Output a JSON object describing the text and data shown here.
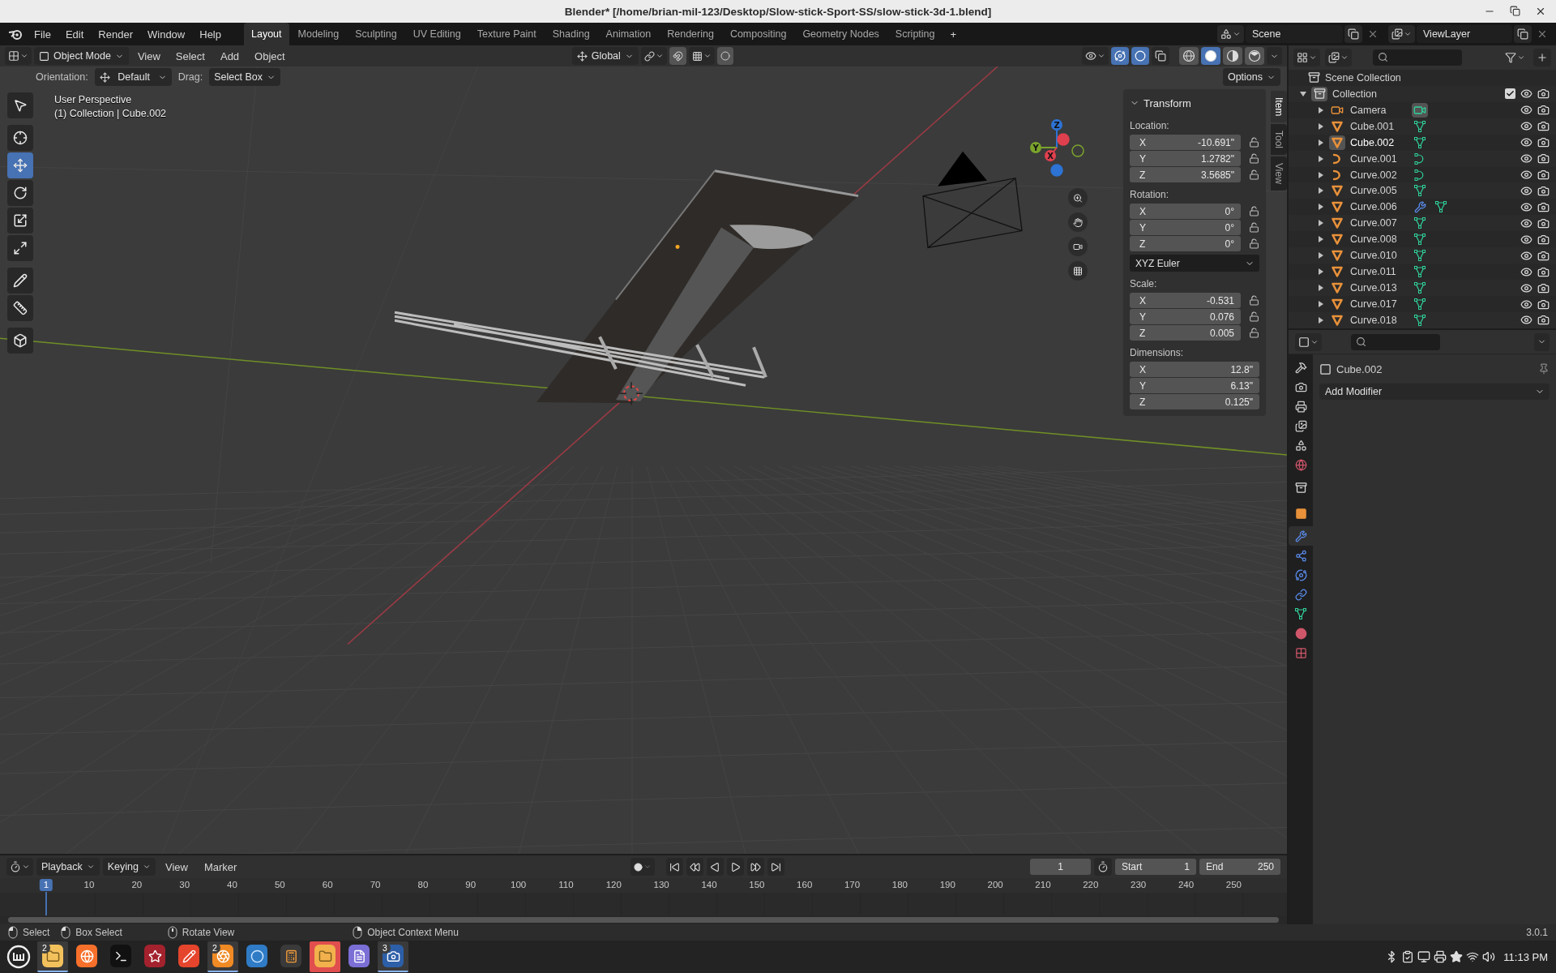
{
  "window": {
    "title": "Blender* [/home/brian-mil-123/Desktop/Slow-stick-Sport-SS/slow-stick-3d-1.blend]"
  },
  "menu": [
    "File",
    "Edit",
    "Render",
    "Window",
    "Help"
  ],
  "workspaces": [
    {
      "label": "Layout",
      "selected": true
    },
    {
      "label": "Modeling",
      "selected": false
    },
    {
      "label": "Sculpting",
      "selected": false
    },
    {
      "label": "UV Editing",
      "selected": false
    },
    {
      "label": "Texture Paint",
      "selected": false
    },
    {
      "label": "Shading",
      "selected": false
    },
    {
      "label": "Animation",
      "selected": false
    },
    {
      "label": "Rendering",
      "selected": false
    },
    {
      "label": "Compositing",
      "selected": false
    },
    {
      "label": "Geometry Nodes",
      "selected": false
    },
    {
      "label": "Scripting",
      "selected": false
    }
  ],
  "add_workspace": "+",
  "scene": "Scene",
  "view_layer": "ViewLayer",
  "viewport": {
    "mode": "Object Mode",
    "menu": [
      "View",
      "Select",
      "Add",
      "Object"
    ],
    "transform_orientation": "Global",
    "toggles": [
      {
        "kind": "gizmos",
        "on": true
      },
      {
        "kind": "overlays",
        "on": true
      },
      {
        "kind": "xray",
        "on": false
      }
    ],
    "shading": [
      {
        "kind": "wireframe",
        "selected": false
      },
      {
        "kind": "solid",
        "selected": true
      },
      {
        "kind": "material",
        "selected": false
      },
      {
        "kind": "rendered",
        "selected": false
      }
    ],
    "tool_settings": {
      "orientation_label": "Orientation:",
      "orientation": "Default",
      "drag_label": "Drag:",
      "drag": "Select Box",
      "options": "Options"
    },
    "tools": [
      {
        "kind": "select",
        "selected": false
      },
      {
        "kind": "cursor",
        "selected": false
      },
      {
        "kind": "move",
        "selected": true
      },
      {
        "kind": "rotate",
        "selected": false
      },
      {
        "kind": "scale",
        "selected": false
      },
      {
        "kind": "transform",
        "selected": false
      },
      {
        "kind": "annotate",
        "selected": false
      },
      {
        "kind": "measure",
        "selected": false
      },
      {
        "kind": "add-cube",
        "selected": false
      }
    ],
    "overlay_text": [
      "User Perspective",
      "(1) Collection | Cube.002"
    ],
    "gizmo_axes": [
      {
        "kind": "z",
        "label": "Z",
        "color": "#2d73d4"
      },
      {
        "kind": "y",
        "label": "Y",
        "color": "#7ba32c"
      },
      {
        "kind": "x",
        "label": "X",
        "color": "#e0404e"
      }
    ],
    "sidebar_tabs": [
      {
        "label": "Item",
        "selected": true
      },
      {
        "label": "Tool",
        "selected": false
      },
      {
        "label": "View",
        "selected": false
      }
    ],
    "transform": {
      "title": "Transform",
      "sections": [
        {
          "kind": "vector",
          "label": "Location:",
          "locked": false,
          "fields": [
            {
              "axis": "X",
              "value": "-10.691\""
            },
            {
              "axis": "Y",
              "value": "1.2782\""
            },
            {
              "axis": "Z",
              "value": "3.5685\""
            }
          ]
        },
        {
          "kind": "vector",
          "label": "Rotation:",
          "locked": false,
          "fields": [
            {
              "axis": "X",
              "value": "0°"
            },
            {
              "axis": "Y",
              "value": "0°"
            },
            {
              "axis": "Z",
              "value": "0°"
            }
          ]
        },
        {
          "kind": "dropdown",
          "value": "XYZ Euler"
        },
        {
          "kind": "vector",
          "label": "Scale:",
          "locked": false,
          "fields": [
            {
              "axis": "X",
              "value": "-0.531"
            },
            {
              "axis": "Y",
              "value": "0.076"
            },
            {
              "axis": "Z",
              "value": "0.005"
            }
          ]
        },
        {
          "kind": "vector",
          "label": "Dimensions:",
          "fields": [
            {
              "axis": "X",
              "value": "12.8\""
            },
            {
              "axis": "Y",
              "value": "6.13\""
            },
            {
              "axis": "Z",
              "value": "0.125\""
            }
          ]
        }
      ]
    }
  },
  "outliner": {
    "root": "Scene Collection",
    "collections": [
      {
        "name": "Collection",
        "expanded": true,
        "checked": true,
        "children": [
          {
            "name": "Camera",
            "kind": "camera",
            "data": [
              {
                "kind": "camera"
              }
            ],
            "data_active": true,
            "selected": false
          },
          {
            "name": "Cube.001",
            "kind": "mesh",
            "data": [
              {
                "kind": "mesh"
              }
            ],
            "data_active": false,
            "selected": false
          },
          {
            "name": "Cube.002",
            "kind": "mesh",
            "data": [
              {
                "kind": "mesh"
              }
            ],
            "data_active": false,
            "selected": true
          },
          {
            "name": "Curve.001",
            "kind": "curve",
            "data": [
              {
                "kind": "curve"
              }
            ],
            "data_active": false,
            "selected": false
          },
          {
            "name": "Curve.002",
            "kind": "curve",
            "data": [
              {
                "kind": "curve"
              }
            ],
            "data_active": false,
            "selected": false
          },
          {
            "name": "Curve.005",
            "kind": "mesh",
            "data": [
              {
                "kind": "mesh"
              }
            ],
            "data_active": false,
            "selected": false
          },
          {
            "name": "Curve.006",
            "kind": "mesh",
            "data": [
              {
                "kind": "modifier"
              },
              {
                "kind": "mesh"
              }
            ],
            "data_active": false,
            "selected": false
          },
          {
            "name": "Curve.007",
            "kind": "mesh",
            "data": [
              {
                "kind": "mesh"
              }
            ],
            "data_active": false,
            "selected": false
          },
          {
            "name": "Curve.008",
            "kind": "mesh",
            "data": [
              {
                "kind": "mesh"
              }
            ],
            "data_active": false,
            "selected": false
          },
          {
            "name": "Curve.010",
            "kind": "mesh",
            "data": [
              {
                "kind": "mesh"
              }
            ],
            "data_active": false,
            "selected": false
          },
          {
            "name": "Curve.011",
            "kind": "mesh",
            "data": [
              {
                "kind": "mesh"
              }
            ],
            "data_active": false,
            "selected": false
          },
          {
            "name": "Curve.013",
            "kind": "mesh",
            "data": [
              {
                "kind": "mesh"
              }
            ],
            "data_active": false,
            "selected": false
          },
          {
            "name": "Curve.017",
            "kind": "mesh",
            "data": [
              {
                "kind": "mesh"
              }
            ],
            "data_active": false,
            "selected": false
          },
          {
            "name": "Curve.018",
            "kind": "mesh",
            "data": [
              {
                "kind": "mesh"
              }
            ],
            "data_active": false,
            "selected": false
          }
        ]
      }
    ]
  },
  "properties": {
    "object": "Cube.002",
    "add_modifier": "Add Modifier",
    "tabs": [
      {
        "kind": "tool",
        "selected": false
      },
      {
        "kind": "render",
        "selected": false
      },
      {
        "kind": "output",
        "selected": false
      },
      {
        "kind": "view_layer",
        "selected": false
      },
      {
        "kind": "scene",
        "selected": false
      },
      {
        "kind": "world",
        "selected": false
      },
      {
        "kind": "collection",
        "selected": false
      },
      {
        "kind": "object",
        "selected": false
      },
      {
        "kind": "modifiers",
        "selected": true
      },
      {
        "kind": "particles",
        "selected": false
      },
      {
        "kind": "physics",
        "selected": false
      },
      {
        "kind": "constraints",
        "selected": false
      },
      {
        "kind": "data",
        "selected": false
      },
      {
        "kind": "material",
        "selected": false
      },
      {
        "kind": "texture",
        "selected": false
      }
    ]
  },
  "timeline": {
    "menu": [
      "Playback",
      "Keying",
      "View",
      "Marker"
    ],
    "frame": "1",
    "start_label": "Start",
    "start": "1",
    "end_label": "End",
    "end": "250",
    "current_frame": "1",
    "ticks": [
      "10",
      "20",
      "30",
      "40",
      "50",
      "60",
      "70",
      "80",
      "90",
      "100",
      "110",
      "120",
      "130",
      "140",
      "150",
      "160",
      "170",
      "180",
      "190",
      "200",
      "210",
      "220",
      "230",
      "240",
      "250"
    ]
  },
  "status_bar": {
    "hints": [
      {
        "kind": "left",
        "label": "Select"
      },
      {
        "kind": "drag",
        "label": "Box Select"
      },
      {
        "kind": "middle",
        "label": "Rotate View"
      },
      {
        "kind": "right",
        "label": "Object Context Menu"
      }
    ],
    "version": "3.0.1"
  },
  "taskbar": {
    "apps": [
      {
        "kind": "files",
        "badge": "2",
        "open": true,
        "urgent": false
      },
      {
        "kind": "browser",
        "open": false,
        "urgent": false
      },
      {
        "kind": "terminal",
        "open": false,
        "urgent": false
      },
      {
        "kind": "dragon",
        "open": false,
        "urgent": false
      },
      {
        "kind": "paint",
        "open": false,
        "urgent": false
      },
      {
        "kind": "modeler",
        "badge": "2",
        "open": true,
        "urgent": false
      },
      {
        "kind": "globe",
        "open": false,
        "urgent": false
      },
      {
        "kind": "calculator",
        "open": false,
        "urgent": false
      },
      {
        "kind": "folder",
        "open": false,
        "urgent": true
      },
      {
        "kind": "notes",
        "open": false,
        "urgent": false
      },
      {
        "kind": "screenshot",
        "badge": "3",
        "open": true,
        "urgent": false
      }
    ],
    "clock": "11:13 PM"
  }
}
